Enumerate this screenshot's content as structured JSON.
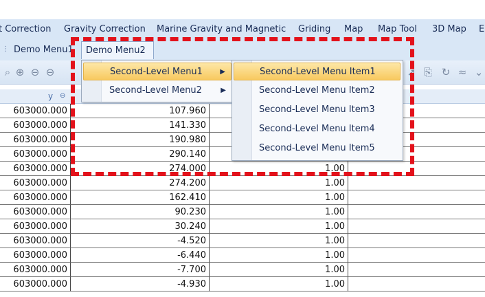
{
  "menubar": {
    "items": [
      "t Correction",
      "Gravity Correction",
      "Marine Gravity and Magnetic",
      "Griding",
      "Map",
      "Map Tool",
      "3D Map",
      "E"
    ]
  },
  "demo_menus": [
    "Demo Menu1",
    "Demo Menu2"
  ],
  "grid": {
    "header_y": "y",
    "rows": [
      [
        "603000.000",
        "107.960",
        "",
        ""
      ],
      [
        "603000.000",
        "141.330",
        "",
        ""
      ],
      [
        "603000.000",
        "190.980",
        "",
        ""
      ],
      [
        "603000.000",
        "290.140",
        "",
        ""
      ],
      [
        "603000.000",
        "274.000",
        "1.00",
        ""
      ],
      [
        "603000.000",
        "274.200",
        "1.00",
        ""
      ],
      [
        "603000.000",
        "162.410",
        "1.00",
        ""
      ],
      [
        "603000.000",
        "90.230",
        "1.00",
        ""
      ],
      [
        "603000.000",
        "30.240",
        "1.00",
        ""
      ],
      [
        "603000.000",
        "-4.520",
        "1.00",
        ""
      ],
      [
        "603000.000",
        "-6.440",
        "1.00",
        ""
      ],
      [
        "603000.000",
        "-7.700",
        "1.00",
        ""
      ],
      [
        "603000.000",
        "-4.930",
        "1.00",
        ""
      ]
    ]
  },
  "dropdown": {
    "items": [
      "Second-Level Menu1",
      "Second-Level Menu2"
    ]
  },
  "submenu": {
    "items": [
      "Second-Level Menu Item1",
      "Second-Level Menu Item2",
      "Second-Level Menu Item3",
      "Second-Level Menu Item4",
      "Second-Level Menu Item5"
    ]
  },
  "colors": {
    "annotation": "#e3121b",
    "highlight": "#f8c95f",
    "menubar": "#d8e6f6"
  }
}
